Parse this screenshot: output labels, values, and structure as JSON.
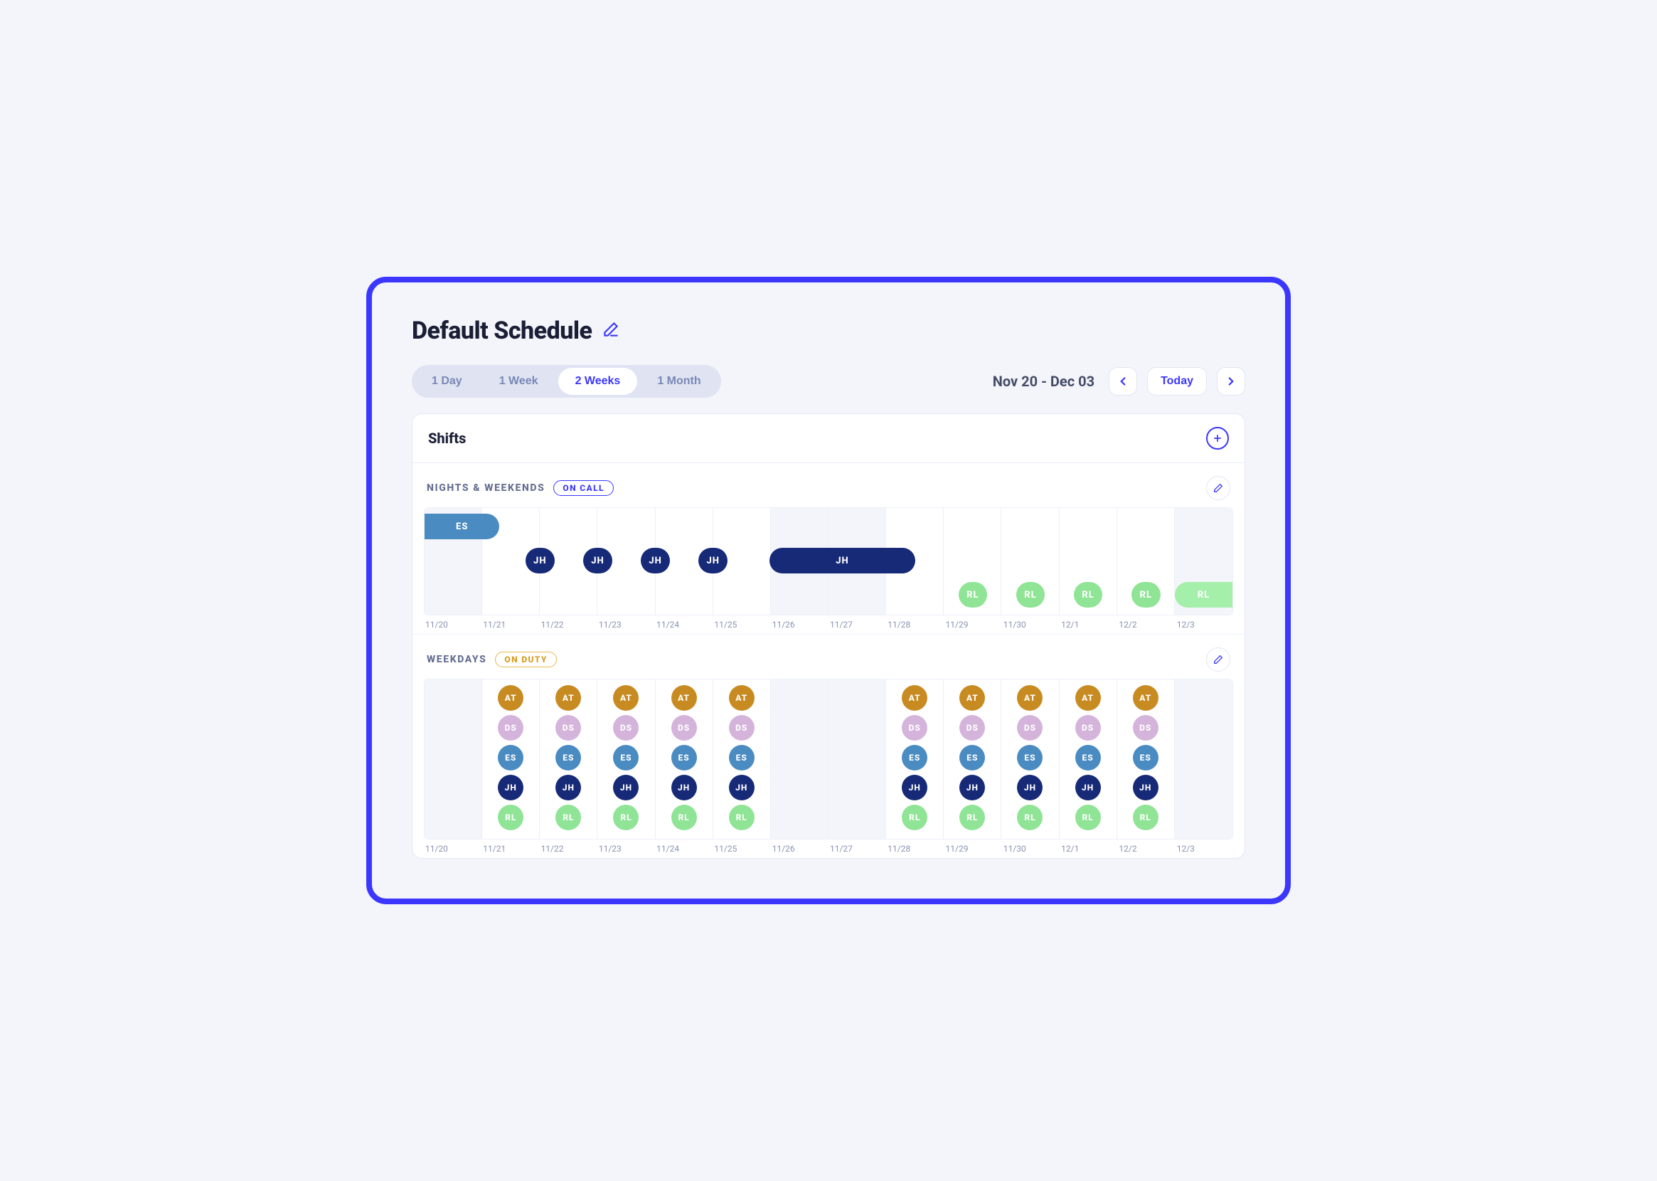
{
  "title": "Default Schedule",
  "segments": {
    "items": [
      "1 Day",
      "1 Week",
      "2 Weeks",
      "1 Month"
    ],
    "active_index": 2
  },
  "range_text": "Nov 20 - Dec 03",
  "today_label": "Today",
  "panel": {
    "title": "Shifts"
  },
  "dates": [
    "11/20",
    "11/21",
    "11/22",
    "11/23",
    "11/24",
    "11/25",
    "11/26",
    "11/27",
    "11/28",
    "11/29",
    "11/30",
    "12/1",
    "12/2",
    "12/3"
  ],
  "shaded_indices": [
    0,
    6,
    7,
    13
  ],
  "sections": {
    "nights": {
      "title": "NIGHTS & WEEKENDS",
      "badge": "ON CALL",
      "badge_style": "blue",
      "body_height": 150,
      "lanes": [
        {
          "segments": [
            {
              "label": "ES",
              "start": 0.0,
              "end": 1.3,
              "color": "c-es",
              "start_flat": true
            }
          ]
        },
        {
          "segments": [
            {
              "label": "JH",
              "start": 1.75,
              "end": 2.25,
              "color": "c-jh"
            },
            {
              "label": "JH",
              "start": 2.75,
              "end": 3.25,
              "color": "c-jh"
            },
            {
              "label": "JH",
              "start": 3.75,
              "end": 4.25,
              "color": "c-jh"
            },
            {
              "label": "JH",
              "start": 4.75,
              "end": 5.25,
              "color": "c-jh"
            },
            {
              "label": "JH",
              "start": 5.98,
              "end": 8.5,
              "color": "c-jh"
            }
          ]
        },
        {
          "segments": [
            {
              "label": "RL",
              "start": 9.25,
              "end": 9.75,
              "color": "c-rl"
            },
            {
              "label": "RL",
              "start": 10.25,
              "end": 10.75,
              "color": "c-rl"
            },
            {
              "label": "RL",
              "start": 11.25,
              "end": 11.75,
              "color": "c-rl"
            },
            {
              "label": "RL",
              "start": 12.25,
              "end": 12.75,
              "color": "c-rl"
            },
            {
              "label": "RL",
              "start": 13.0,
              "end": 14.0,
              "color": "c-rl-big",
              "end_flat": true
            }
          ]
        }
      ]
    },
    "weekdays": {
      "title": "WEEKDAYS",
      "badge": "ON DUTY",
      "badge_style": "gold",
      "columns": [
        [],
        [
          {
            "label": "AT",
            "color": "c-at"
          },
          {
            "label": "DS",
            "color": "c-ds"
          },
          {
            "label": "ES",
            "color": "c-es"
          },
          {
            "label": "JH",
            "color": "c-jh"
          },
          {
            "label": "RL",
            "color": "c-rl"
          }
        ],
        [
          {
            "label": "AT",
            "color": "c-at"
          },
          {
            "label": "DS",
            "color": "c-ds"
          },
          {
            "label": "ES",
            "color": "c-es"
          },
          {
            "label": "JH",
            "color": "c-jh"
          },
          {
            "label": "RL",
            "color": "c-rl"
          }
        ],
        [
          {
            "label": "AT",
            "color": "c-at"
          },
          {
            "label": "DS",
            "color": "c-ds"
          },
          {
            "label": "ES",
            "color": "c-es"
          },
          {
            "label": "JH",
            "color": "c-jh"
          },
          {
            "label": "RL",
            "color": "c-rl"
          }
        ],
        [
          {
            "label": "AT",
            "color": "c-at"
          },
          {
            "label": "DS",
            "color": "c-ds"
          },
          {
            "label": "ES",
            "color": "c-es"
          },
          {
            "label": "JH",
            "color": "c-jh"
          },
          {
            "label": "RL",
            "color": "c-rl"
          }
        ],
        [
          {
            "label": "AT",
            "color": "c-at"
          },
          {
            "label": "DS",
            "color": "c-ds"
          },
          {
            "label": "ES",
            "color": "c-es"
          },
          {
            "label": "JH",
            "color": "c-jh"
          },
          {
            "label": "RL",
            "color": "c-rl"
          }
        ],
        [],
        [],
        [
          {
            "label": "AT",
            "color": "c-at"
          },
          {
            "label": "DS",
            "color": "c-ds"
          },
          {
            "label": "ES",
            "color": "c-es"
          },
          {
            "label": "JH",
            "color": "c-jh"
          },
          {
            "label": "RL",
            "color": "c-rl"
          }
        ],
        [
          {
            "label": "AT",
            "color": "c-at"
          },
          {
            "label": "DS",
            "color": "c-ds"
          },
          {
            "label": "ES",
            "color": "c-es"
          },
          {
            "label": "JH",
            "color": "c-jh"
          },
          {
            "label": "RL",
            "color": "c-rl"
          }
        ],
        [
          {
            "label": "AT",
            "color": "c-at"
          },
          {
            "label": "DS",
            "color": "c-ds"
          },
          {
            "label": "ES",
            "color": "c-es"
          },
          {
            "label": "JH",
            "color": "c-jh"
          },
          {
            "label": "RL",
            "color": "c-rl"
          }
        ],
        [
          {
            "label": "AT",
            "color": "c-at"
          },
          {
            "label": "DS",
            "color": "c-ds"
          },
          {
            "label": "ES",
            "color": "c-es"
          },
          {
            "label": "JH",
            "color": "c-jh"
          },
          {
            "label": "RL",
            "color": "c-rl"
          }
        ],
        [
          {
            "label": "AT",
            "color": "c-at"
          },
          {
            "label": "DS",
            "color": "c-ds"
          },
          {
            "label": "ES",
            "color": "c-es"
          },
          {
            "label": "JH",
            "color": "c-jh"
          },
          {
            "label": "RL",
            "color": "c-rl"
          }
        ],
        []
      ]
    }
  }
}
